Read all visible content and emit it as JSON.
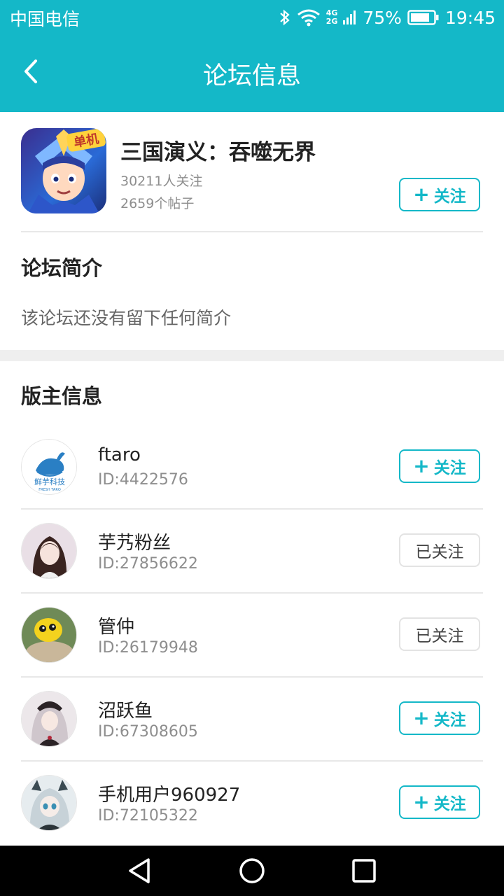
{
  "status_bar": {
    "carrier": "中国电信",
    "net_top": "4G",
    "net_bottom": "2G",
    "battery": "75%",
    "time": "19:45"
  },
  "header": {
    "title": "论坛信息",
    "back_icon": "chevron-left-icon"
  },
  "forum": {
    "name": "三国演义：吞噬无界",
    "icon_badge": "单机",
    "followers": "30211人关注",
    "posts": "2659个帖子",
    "follow_label": "关注"
  },
  "intro": {
    "heading": "论坛简介",
    "text": "该论坛还没有留下任何简介"
  },
  "moderators": {
    "heading": "版主信息",
    "items": [
      {
        "name": "ftaro",
        "id": "ID:4422576",
        "button": "关注",
        "followed": false,
        "avatar_text": "鲜芋科技",
        "avatar_subtext": "FRESH TARO"
      },
      {
        "name": "芋艿粉丝",
        "id": "ID:27856622",
        "button": "已关注",
        "followed": true
      },
      {
        "name": "管仲",
        "id": "ID:26179948",
        "button": "已关注",
        "followed": true
      },
      {
        "name": "沼跃鱼",
        "id": "ID:67308605",
        "button": "关注",
        "followed": false
      },
      {
        "name": "手机用户960927",
        "id": "ID:72105322",
        "button": "关注",
        "followed": false
      }
    ]
  },
  "colors": {
    "accent": "#14b8c8",
    "divider": "#e8e8e8",
    "section_gap": "#efefef"
  }
}
